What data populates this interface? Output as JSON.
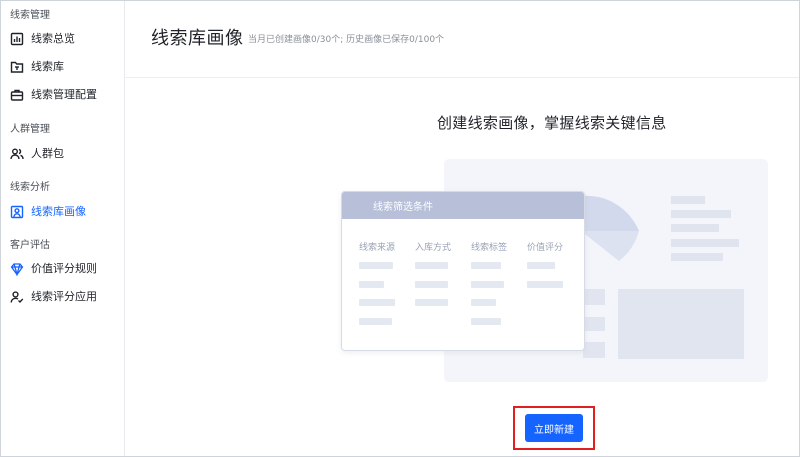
{
  "sidebar": {
    "groups": [
      {
        "title": "线索管理",
        "items": [
          {
            "label": "线索总览",
            "icon": "bar-chart-icon"
          },
          {
            "label": "线索库",
            "icon": "folder-icon"
          },
          {
            "label": "线索管理配置",
            "icon": "briefcase-icon"
          }
        ]
      },
      {
        "title": "人群管理",
        "items": [
          {
            "label": "人群包",
            "icon": "users-icon"
          }
        ]
      },
      {
        "title": "线索分析",
        "items": [
          {
            "label": "线索库画像",
            "icon": "portrait-icon"
          }
        ]
      },
      {
        "title": "客户评估",
        "items": [
          {
            "label": "价值评分规则",
            "icon": "diamond-icon"
          },
          {
            "label": "线索评分应用",
            "icon": "user-check-icon"
          }
        ]
      }
    ],
    "active_item": "线索库画像"
  },
  "header": {
    "title": "线索库画像",
    "subtitle": "当月已创建画像0/30个; 历史画像已保存0/100个"
  },
  "main": {
    "hero_title": "创建线索画像，掌握线索关键信息",
    "illustration": {
      "card_title": "线索筛选条件",
      "columns": [
        "线索来源",
        "入库方式",
        "线索标签",
        "价值评分"
      ]
    },
    "create_button_label": "立即新建"
  },
  "colors": {
    "accent": "#1664ff",
    "highlight_border": "#e02020",
    "card_header": "#b7bfd9",
    "placeholder": "#e4e8f1"
  }
}
